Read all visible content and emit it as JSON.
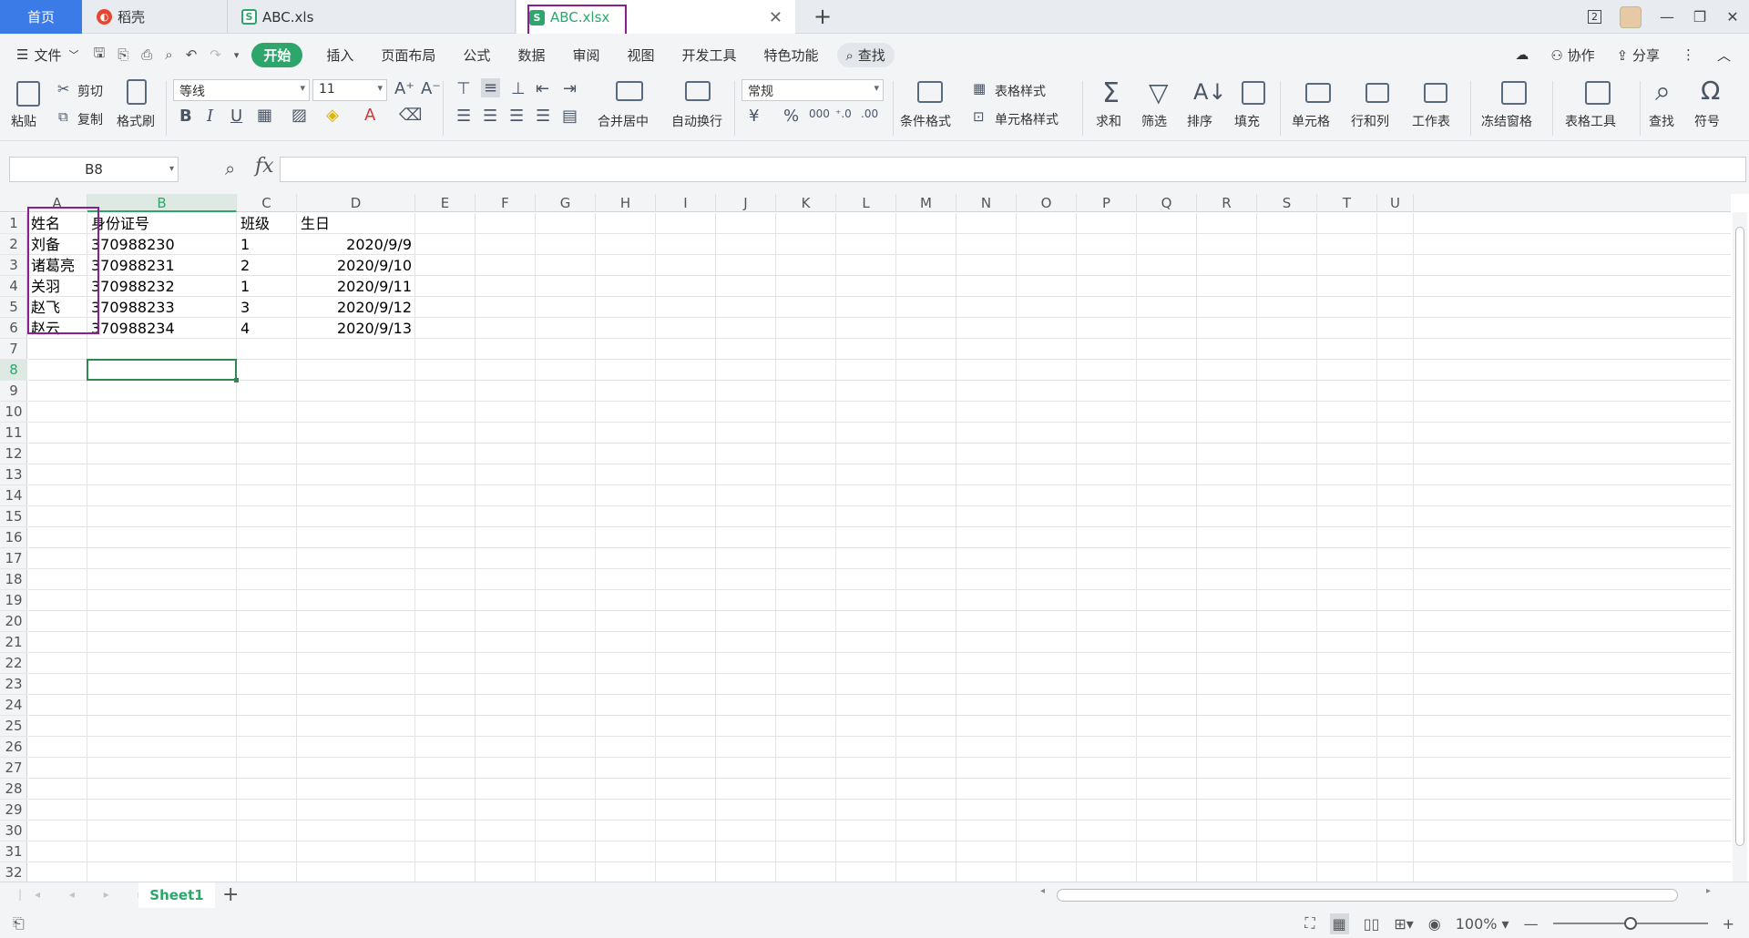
{
  "tabs": {
    "home": "首页",
    "docer": "稻壳",
    "file1": "ABC.xls",
    "file2": "ABC.xlsx",
    "window_count": "2"
  },
  "menu": {
    "file": "文件",
    "start": "开始",
    "items": [
      "插入",
      "页面布局",
      "公式",
      "数据",
      "审阅",
      "视图",
      "开发工具",
      "特色功能"
    ],
    "search": "查找",
    "collab": "协作",
    "share": "分享"
  },
  "ribbon": {
    "paste": "粘贴",
    "cut": "剪切",
    "copy": "复制",
    "format_painter": "格式刷",
    "font_name": "等线",
    "font_size": "11",
    "merge_center": "合并居中",
    "wrap_text": "自动换行",
    "number_format": "常规",
    "conditional_format": "条件格式",
    "table_style": "表格样式",
    "cell_style": "单元格样式",
    "sum": "求和",
    "filter": "筛选",
    "sort": "排序",
    "fill": "填充",
    "cell": "单元格",
    "row_col": "行和列",
    "worksheet": "工作表",
    "freeze": "冻结窗格",
    "table_tools": "表格工具",
    "find": "查找",
    "symbol": "符号"
  },
  "formula_bar": {
    "name_box": "B8",
    "fx": "fx",
    "content": ""
  },
  "grid": {
    "columns": [
      "A",
      "B",
      "C",
      "D",
      "E",
      "F",
      "G",
      "H",
      "I",
      "J",
      "K",
      "L",
      "M",
      "N",
      "O",
      "P",
      "Q",
      "R",
      "S",
      "T",
      "U"
    ],
    "selected_column": "B",
    "selected_row": 8,
    "row_count": 32,
    "rows": [
      [
        "姓名",
        "身份证号",
        "班级",
        "生日"
      ],
      [
        "刘备",
        "370988230",
        "1",
        "2020/9/9"
      ],
      [
        "诸葛亮",
        "370988231",
        "2",
        "2020/9/10"
      ],
      [
        "关羽",
        "370988232",
        "1",
        "2020/9/11"
      ],
      [
        "赵飞",
        "370988233",
        "3",
        "2020/9/12"
      ],
      [
        "赵云",
        "370988234",
        "4",
        "2020/9/13"
      ]
    ]
  },
  "sheets": [
    "Sheet1"
  ],
  "status": {
    "zoom": "100%"
  },
  "colors": {
    "accent": "#2ea66b",
    "highlight_box": "#8a1f8f",
    "home_tab": "#3b7be8"
  }
}
